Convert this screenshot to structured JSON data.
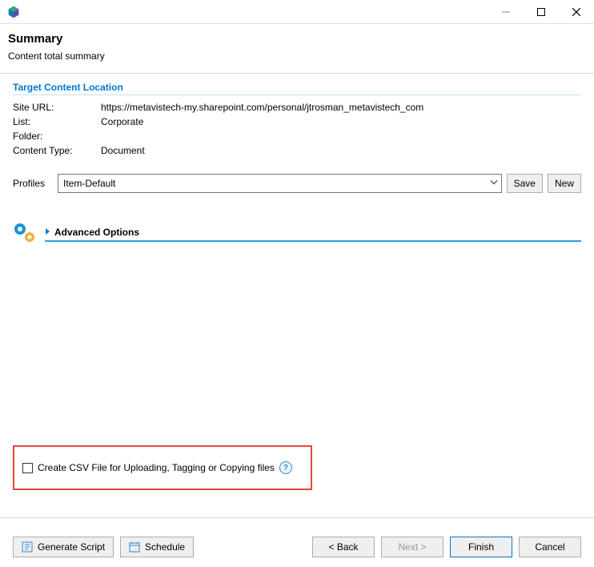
{
  "header": {
    "title": "Summary",
    "subtitle": "Content total summary"
  },
  "target": {
    "section_title": "Target Content Location",
    "site_url_label": "Site URL:",
    "site_url": "https://metavistech-my.sharepoint.com/personal/jtrosman_metavistech_com",
    "list_label": "List:",
    "list": "Corporate",
    "folder_label": "Folder:",
    "folder": "",
    "content_type_label": "Content Type:",
    "content_type": "Document"
  },
  "profiles": {
    "label": "Profiles",
    "selected": "Item-Default",
    "save_label": "Save",
    "new_label": "New"
  },
  "advanced": {
    "label": "Advanced Options"
  },
  "csv": {
    "label": "Create CSV File for Uploading, Tagging or Copying files"
  },
  "footer": {
    "generate_script": "Generate Script",
    "schedule": "Schedule",
    "back": "< Back",
    "next": "Next >",
    "finish": "Finish",
    "cancel": "Cancel"
  }
}
